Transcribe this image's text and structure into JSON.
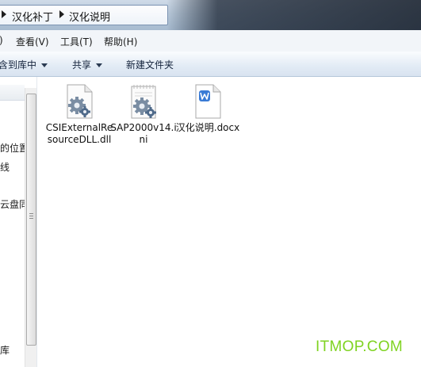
{
  "address_bar": {
    "crumbs": [
      "汉化补丁",
      "汉化说明"
    ]
  },
  "menu": {
    "items": [
      "查看(V)",
      "工具(T)",
      "帮助(H)"
    ]
  },
  "commands": {
    "include_library": "含到库中",
    "share": "共享",
    "new_folder": "新建文件夹"
  },
  "nav_pane": {
    "items": [
      "的位置",
      "线",
      "云盘同",
      "库"
    ]
  },
  "files": [
    {
      "name": "CSIExternalResourceDLL.dll",
      "icon": "dll-gear-icon"
    },
    {
      "name": "SAP2000v14.ini",
      "icon": "ini-gear-icon"
    },
    {
      "name": "汉化说明.docx",
      "icon": "wps-word-doc-icon"
    }
  ],
  "watermark": "ITMOP.COM",
  "colors": {
    "watermark": "#7fd321",
    "wps_blue": "#3a7bd5"
  }
}
